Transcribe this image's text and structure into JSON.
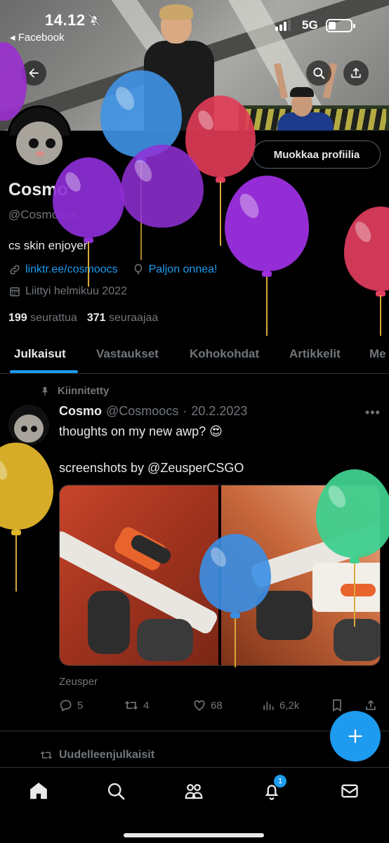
{
  "status_bar": {
    "time": "14.12",
    "network": "5G",
    "back_app": "Facebook"
  },
  "profile": {
    "name": "Cosmo",
    "handle": "@Cosmoocs",
    "bio": "cs skin enjoyer",
    "link": "linktr.ee/cosmoocs",
    "birthday": "Paljon onnea!",
    "joined": "Liittyi helmikuu 2022",
    "following_count": "199",
    "following_label": "seurattua",
    "followers_count": "371",
    "followers_label": "seuraajaa",
    "edit_button": "Muokkaa profiilia"
  },
  "tabs": [
    "Julkaisut",
    "Vastaukset",
    "Kohokohdat",
    "Artikkelit",
    "Me"
  ],
  "pinned_post": {
    "pinned_label": "Kiinnitetty",
    "author": "Cosmo",
    "handle": "@Cosmoocs",
    "date": "20.2.2023",
    "text_line1": "thoughts on my new awp? 😍",
    "text_line2": "screenshots by @ZeusperCSGO",
    "source": "Zeusper",
    "replies": "5",
    "reposts": "4",
    "likes": "68",
    "views": "6,2k"
  },
  "next_post": {
    "repost_label": "Uudelleenjulkaisit"
  },
  "bottom_nav": {
    "notifications_badge": "1"
  },
  "icons": [
    "back-arrow-icon",
    "search-icon",
    "share-icon",
    "link-icon",
    "balloon-icon",
    "calendar-icon",
    "pin-icon",
    "reply-icon",
    "repost-icon",
    "like-icon",
    "views-icon",
    "bookmark-icon",
    "plus-icon",
    "home-icon",
    "communities-icon",
    "bell-icon",
    "mail-icon"
  ],
  "colors": {
    "accent": "#1d9bf0",
    "background": "#000000",
    "muted": "#71767b",
    "text": "#e7e9ea"
  }
}
